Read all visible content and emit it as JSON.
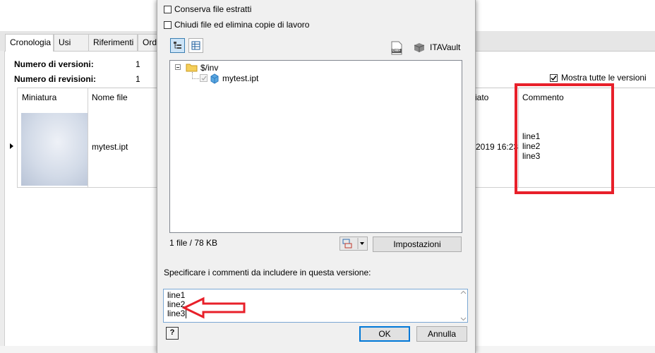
{
  "tabs": [
    "Cronologia",
    "Usi",
    "Riferimenti",
    "Ord"
  ],
  "info": {
    "versions_label": "Numero di versioni:",
    "versions_value": "1",
    "revisions_label": "Numero di revisioni:",
    "revisions_value": "1"
  },
  "show_all_versions": {
    "label": "Mostra tutte le versioni",
    "checked": true
  },
  "grid": {
    "columns": {
      "thumbnail": "Miniatura",
      "filename": "Nome file",
      "date": "iato",
      "comment": "Commento"
    },
    "row": {
      "filename": "mytest.ipt",
      "date": "2019 16:23",
      "comment_lines": [
        "line1",
        "line2",
        "line3"
      ]
    }
  },
  "dialog": {
    "keep_checked_out": {
      "label": "Conserva file estratti",
      "checked": false
    },
    "close_delete_copies": {
      "label": "Chiudi file ed elimina copie di lavoro",
      "checked": false
    },
    "dwf_icon_label": "DWF",
    "vault_label": "ITAVault",
    "tree": {
      "root": "$/inv",
      "child": "mytest.ipt"
    },
    "file_summary": "1 file / 78 KB",
    "settings_button": "Impostazioni",
    "comment_prompt": "Specificare i commenti da includere in questa versione:",
    "comment_lines": [
      "line1",
      "line2",
      "line3"
    ],
    "help_button": "?",
    "ok_button": "OK",
    "cancel_button": "Annulla"
  },
  "colors": {
    "highlight_red": "#e8202a",
    "default_button_blue": "#0078d7"
  }
}
